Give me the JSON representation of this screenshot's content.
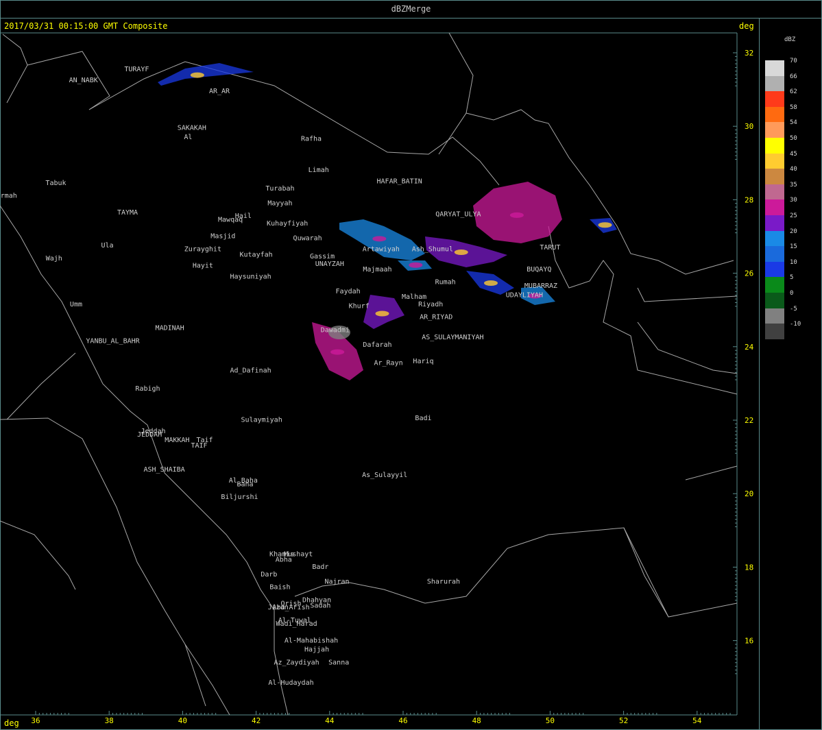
{
  "header": {
    "window_title": "dBZMerge",
    "subtitle": "2017/03/31 00:15:00 GMT Composite",
    "deg_label_top": "deg",
    "deg_label_bottom": "deg"
  },
  "axes": {
    "lon_ticks": [
      "36",
      "38",
      "40",
      "42",
      "44",
      "46",
      "48",
      "50",
      "52",
      "54"
    ],
    "lat_ticks": [
      "32",
      "30",
      "28",
      "26",
      "24",
      "22",
      "20",
      "18",
      "16"
    ]
  },
  "legend": {
    "title": "dBZ",
    "items": [
      {
        "label": "70",
        "color": "#d8d8d8"
      },
      {
        "label": "66",
        "color": "#b0b0b0"
      },
      {
        "label": "62",
        "color": "#ff3a1a"
      },
      {
        "label": "58",
        "color": "#ff6a10"
      },
      {
        "label": "54",
        "color": "#ff9a5a"
      },
      {
        "label": "50",
        "color": "#ffff00"
      },
      {
        "label": "45",
        "color": "#ffcc30"
      },
      {
        "label": "40",
        "color": "#cc8840"
      },
      {
        "label": "35",
        "color": "#c06890"
      },
      {
        "label": "30",
        "color": "#cc1a9a"
      },
      {
        "label": "25",
        "color": "#7a1ac8"
      },
      {
        "label": "20",
        "color": "#1a8ae6"
      },
      {
        "label": "15",
        "color": "#1a6adc"
      },
      {
        "label": "10",
        "color": "#1a3ae6"
      },
      {
        "label": "5",
        "color": "#0a8a1a"
      },
      {
        "label": "0",
        "color": "#0a5a1a"
      },
      {
        "label": "-5",
        "color": "#808080"
      },
      {
        "label": "-10",
        "color": "#404040"
      }
    ]
  },
  "cities": [
    {
      "name": "TURAYF",
      "lon": 38.75,
      "lat": 31.5
    },
    {
      "name": "AN_NABK",
      "lon": 37.3,
      "lat": 31.2
    },
    {
      "name": "AR_AR",
      "lon": 41.0,
      "lat": 30.9
    },
    {
      "name": "SAKAKAH",
      "lon": 40.25,
      "lat": 29.9
    },
    {
      "name": "Al",
      "lon": 40.15,
      "lat": 29.65
    },
    {
      "name": "Rafha",
      "lon": 43.5,
      "lat": 29.6
    },
    {
      "name": "Limah",
      "lon": 43.7,
      "lat": 28.75
    },
    {
      "name": "HAFAR_BATIN",
      "lon": 45.9,
      "lat": 28.45
    },
    {
      "name": "Tabuk",
      "lon": 36.55,
      "lat": 28.4
    },
    {
      "name": "Sharmah",
      "lon": 35.1,
      "lat": 28.05
    },
    {
      "name": "Turabah",
      "lon": 42.65,
      "lat": 28.25
    },
    {
      "name": "Mayyah",
      "lon": 42.65,
      "lat": 27.85
    },
    {
      "name": "TAYMA",
      "lon": 38.5,
      "lat": 27.6
    },
    {
      "name": "Hail",
      "lon": 41.65,
      "lat": 27.5
    },
    {
      "name": "Mawqaq",
      "lon": 41.3,
      "lat": 27.4
    },
    {
      "name": "Kuhayfiyah",
      "lon": 42.85,
      "lat": 27.3
    },
    {
      "name": "QARYAT_ULYA",
      "lon": 47.5,
      "lat": 27.55
    },
    {
      "name": "Masjid",
      "lon": 41.1,
      "lat": 26.95
    },
    {
      "name": "Quwarah",
      "lon": 43.4,
      "lat": 26.9
    },
    {
      "name": "Ula",
      "lon": 37.95,
      "lat": 26.7
    },
    {
      "name": "Artawiyah",
      "lon": 45.4,
      "lat": 26.6
    },
    {
      "name": "Ash_Shumul",
      "lon": 46.8,
      "lat": 26.6
    },
    {
      "name": "TARUT",
      "lon": 50.0,
      "lat": 26.65
    },
    {
      "name": "Zurayghit",
      "lon": 40.55,
      "lat": 26.6
    },
    {
      "name": "Kutayfah",
      "lon": 42.0,
      "lat": 26.45
    },
    {
      "name": "Gassim",
      "lon": 43.8,
      "lat": 26.4
    },
    {
      "name": "UNAYZAH",
      "lon": 44.0,
      "lat": 26.2
    },
    {
      "name": "Wajh",
      "lon": 36.5,
      "lat": 26.35
    },
    {
      "name": "Hayit",
      "lon": 40.55,
      "lat": 26.15
    },
    {
      "name": "Majmaah",
      "lon": 45.3,
      "lat": 26.05
    },
    {
      "name": "BUQAYQ",
      "lon": 49.7,
      "lat": 26.05
    },
    {
      "name": "Haysuniyah",
      "lon": 41.85,
      "lat": 25.85
    },
    {
      "name": "Rumah",
      "lon": 47.15,
      "lat": 25.7
    },
    {
      "name": "MUBARRAZ",
      "lon": 49.75,
      "lat": 25.6
    },
    {
      "name": "Faydah",
      "lon": 44.5,
      "lat": 25.45
    },
    {
      "name": "UDAYLIYAH",
      "lon": 49.3,
      "lat": 25.35
    },
    {
      "name": "Malham",
      "lon": 46.3,
      "lat": 25.3
    },
    {
      "name": "Riyadh",
      "lon": 46.75,
      "lat": 25.1
    },
    {
      "name": "Khurf",
      "lon": 44.8,
      "lat": 25.05
    },
    {
      "name": "Umm",
      "lon": 37.1,
      "lat": 25.1
    },
    {
      "name": "AR_RIYAD",
      "lon": 46.9,
      "lat": 24.75
    },
    {
      "name": "Dawadmi",
      "lon": 44.15,
      "lat": 24.4
    },
    {
      "name": "MADINAH",
      "lon": 39.65,
      "lat": 24.45
    },
    {
      "name": "AS_SULAYMANIYAH",
      "lon": 47.35,
      "lat": 24.2
    },
    {
      "name": "YANBU_AL_BAHR",
      "lon": 38.1,
      "lat": 24.1
    },
    {
      "name": "Dafarah",
      "lon": 45.3,
      "lat": 24.0
    },
    {
      "name": "Hariq",
      "lon": 46.55,
      "lat": 23.55
    },
    {
      "name": "Ar_Rayn",
      "lon": 45.6,
      "lat": 23.5
    },
    {
      "name": "Ad_Dafinah",
      "lon": 41.85,
      "lat": 23.3
    },
    {
      "name": "Rabigh",
      "lon": 39.05,
      "lat": 22.8
    },
    {
      "name": "Badi",
      "lon": 46.55,
      "lat": 22.0
    },
    {
      "name": "Sulaymiyah",
      "lon": 42.15,
      "lat": 21.95
    },
    {
      "name": "Jeddah",
      "lon": 39.2,
      "lat": 21.65
    },
    {
      "name": "JEDDAH",
      "lon": 39.1,
      "lat": 21.55
    },
    {
      "name": "MAKKAH",
      "lon": 39.85,
      "lat": 21.4
    },
    {
      "name": "Taif",
      "lon": 40.6,
      "lat": 21.4
    },
    {
      "name": "TAIF",
      "lon": 40.45,
      "lat": 21.25
    },
    {
      "name": "ASH_SHAIBA",
      "lon": 39.5,
      "lat": 20.6
    },
    {
      "name": "As_Sulayyil",
      "lon": 45.5,
      "lat": 20.45
    },
    {
      "name": "Al_Baha",
      "lon": 41.65,
      "lat": 20.3
    },
    {
      "name": "Baha",
      "lon": 41.7,
      "lat": 20.2
    },
    {
      "name": "Biljurshi",
      "lon": 41.55,
      "lat": 19.85
    },
    {
      "name": "Khamis",
      "lon": 42.7,
      "lat": 18.3
    },
    {
      "name": "Mushayt",
      "lon": 43.15,
      "lat": 18.3
    },
    {
      "name": "Abha",
      "lon": 42.75,
      "lat": 18.15
    },
    {
      "name": "Badr",
      "lon": 43.75,
      "lat": 17.95
    },
    {
      "name": "Darb",
      "lon": 42.35,
      "lat": 17.75
    },
    {
      "name": "Najran",
      "lon": 44.2,
      "lat": 17.55
    },
    {
      "name": "Sharurah",
      "lon": 47.1,
      "lat": 17.55
    },
    {
      "name": "Baish",
      "lon": 42.65,
      "lat": 17.4
    },
    {
      "name": "Dhahyan",
      "lon": 43.65,
      "lat": 17.05
    },
    {
      "name": "Sadah",
      "lon": 43.75,
      "lat": 16.9
    },
    {
      "name": "Qrish",
      "lon": 42.95,
      "lat": 16.95
    },
    {
      "name": "Jizan",
      "lon": 42.6,
      "lat": 16.85
    },
    {
      "name": "Abu_Arish",
      "lon": 42.95,
      "lat": 16.85
    },
    {
      "name": "Al-Tuwal",
      "lon": 43.05,
      "lat": 16.5
    },
    {
      "name": "Wadi_Harad",
      "lon": 43.1,
      "lat": 16.4
    },
    {
      "name": "Al-Mahabishah",
      "lon": 43.5,
      "lat": 15.95
    },
    {
      "name": "Hajjah",
      "lon": 43.65,
      "lat": 15.7
    },
    {
      "name": "Az_Zaydiyah",
      "lon": 43.1,
      "lat": 15.35
    },
    {
      "name": "Sanna",
      "lon": 44.25,
      "lat": 15.35
    },
    {
      "name": "Al-Hudaydah",
      "lon": 42.95,
      "lat": 14.8
    }
  ]
}
